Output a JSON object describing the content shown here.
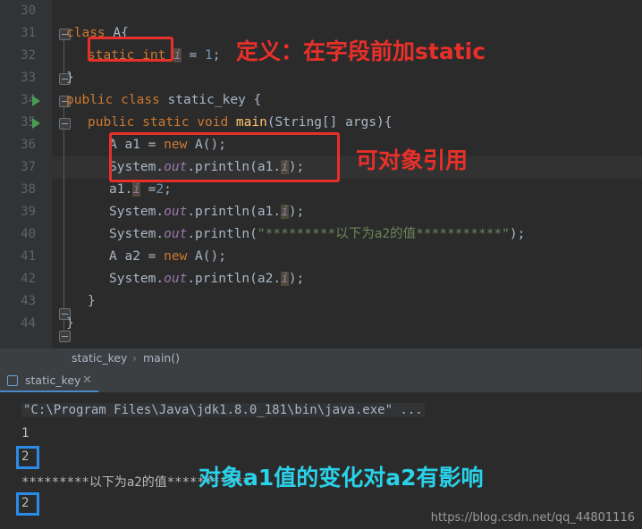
{
  "editor": {
    "lines": [
      {
        "num": "30",
        "indent": 0,
        "code": ""
      },
      {
        "num": "31",
        "indent": 0,
        "code": "class A{"
      },
      {
        "num": "32",
        "indent": 1,
        "code": "static int i = 1;"
      },
      {
        "num": "33",
        "indent": 0,
        "code": "}"
      },
      {
        "num": "34",
        "indent": 0,
        "code": "public class static_key {"
      },
      {
        "num": "35",
        "indent": 1,
        "code": "public static void main(String[] args){"
      },
      {
        "num": "36",
        "indent": 2,
        "code": "A a1 = new A();"
      },
      {
        "num": "37",
        "indent": 2,
        "code": "System.out.println(a1.i);"
      },
      {
        "num": "38",
        "indent": 2,
        "code": "a1.i =2;"
      },
      {
        "num": "39",
        "indent": 2,
        "code": "System.out.println(a1.i);"
      },
      {
        "num": "40",
        "indent": 2,
        "code": "System.out.println(\"*********以下为a2的值***********\");"
      },
      {
        "num": "41",
        "indent": 2,
        "code": "A a2 = new A();"
      },
      {
        "num": "42",
        "indent": 2,
        "code": "System.out.println(a2.i);"
      },
      {
        "num": "43",
        "indent": 1,
        "code": "}"
      },
      {
        "num": "44",
        "indent": 0,
        "code": "}"
      }
    ]
  },
  "annotations": {
    "static_note": "定义：在字段前加static",
    "object_ref_note": "可对象引用",
    "console_note": "对象a1值的变化对a2有影响"
  },
  "breadcrumb": {
    "class": "static_key",
    "separator": "›",
    "method": "main()"
  },
  "run_panel": {
    "tab_label": "static_key",
    "close": "✕",
    "console_lines": [
      "\"C:\\Program Files\\Java\\jdk1.8.0_181\\bin\\java.exe\" ...",
      "1",
      "2",
      "*********以下为a2的值***********",
      "2"
    ]
  },
  "watermark": "https://blog.csdn.net/qq_44801116",
  "colors": {
    "background": "#2b2b2b",
    "gutter": "#313335",
    "annotation_red": "#e8302a",
    "annotation_cyan": "#2ad1e8",
    "annotation_blue": "#2a8ce8",
    "keyword": "#cc7832",
    "string": "#6a8759",
    "field": "#9876aa",
    "number": "#6897bb",
    "method": "#ffc66d",
    "text": "#a9b7c6"
  }
}
